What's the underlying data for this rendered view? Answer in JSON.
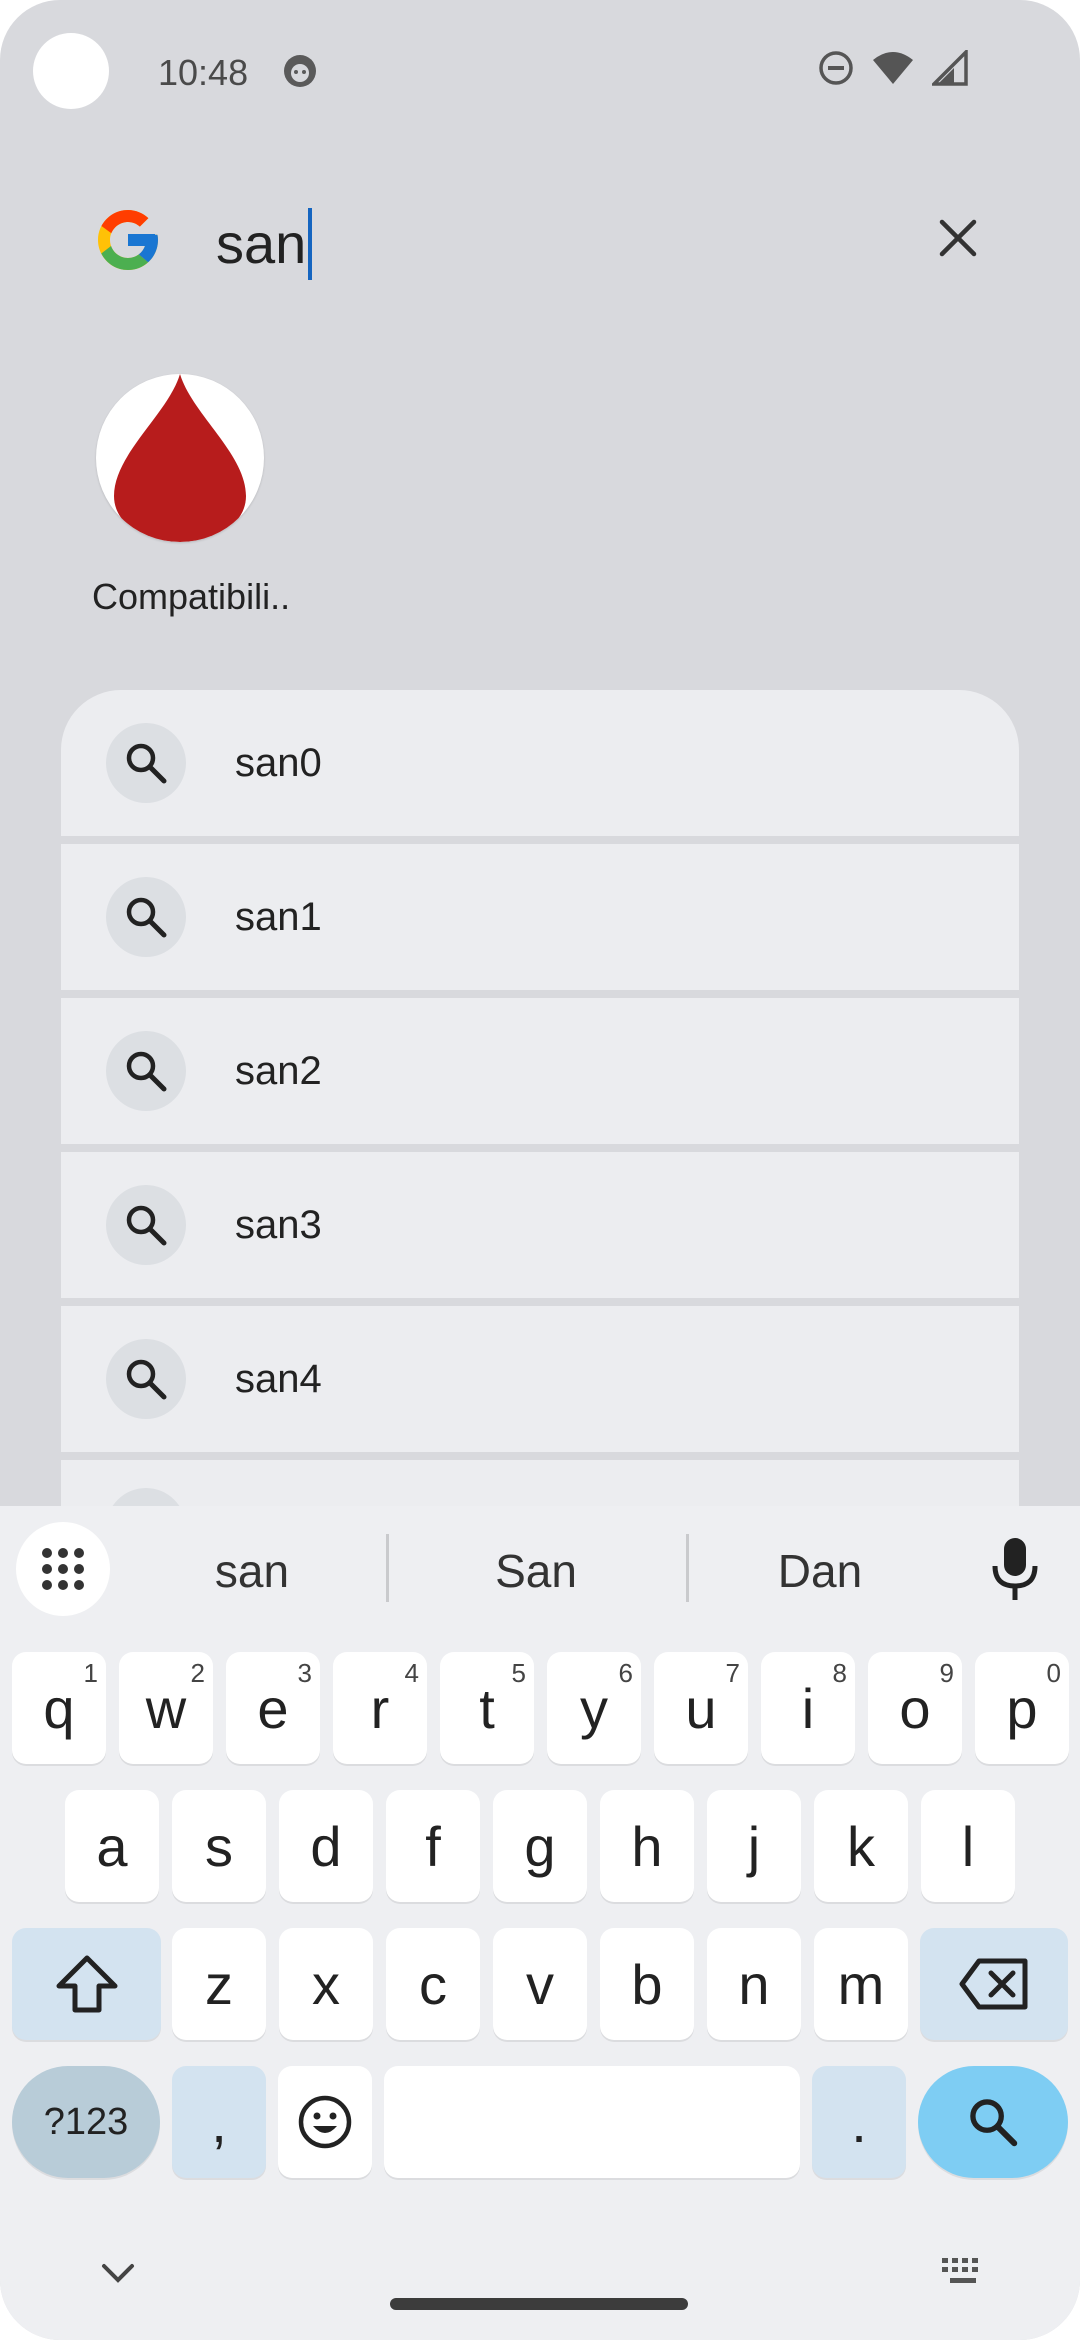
{
  "status_bar": {
    "time": "10:48",
    "icons": [
      "app-notification-icon",
      "do-not-disturb-icon",
      "wifi-icon",
      "cellular-signal-icon"
    ]
  },
  "search": {
    "query": "san",
    "logo": "google-g-icon",
    "clear_icon": "close-icon"
  },
  "app_result": {
    "label": "Compatibili..",
    "icon": "blood-drop-icon",
    "icon_color": "#b71c1c"
  },
  "suggestions": [
    {
      "text": "san0"
    },
    {
      "text": "san1"
    },
    {
      "text": "san2"
    },
    {
      "text": "san3"
    },
    {
      "text": "san4"
    }
  ],
  "keyboard": {
    "suggestions": [
      "san",
      "San",
      "Dan"
    ],
    "row1": [
      {
        "k": "q",
        "s": "1"
      },
      {
        "k": "w",
        "s": "2"
      },
      {
        "k": "e",
        "s": "3"
      },
      {
        "k": "r",
        "s": "4"
      },
      {
        "k": "t",
        "s": "5"
      },
      {
        "k": "y",
        "s": "6"
      },
      {
        "k": "u",
        "s": "7"
      },
      {
        "k": "i",
        "s": "8"
      },
      {
        "k": "o",
        "s": "9"
      },
      {
        "k": "p",
        "s": "0"
      }
    ],
    "row2": [
      "a",
      "s",
      "d",
      "f",
      "g",
      "h",
      "j",
      "k",
      "l"
    ],
    "row3": [
      "z",
      "x",
      "c",
      "v",
      "b",
      "n",
      "m"
    ],
    "symbols_label": "?123",
    "comma": ",",
    "period": ".",
    "colors": {
      "background": "#eeeff2",
      "modifier": "#d3e3f0",
      "symbols": "#b8ccd8",
      "search_key": "#7ecdf3"
    }
  }
}
